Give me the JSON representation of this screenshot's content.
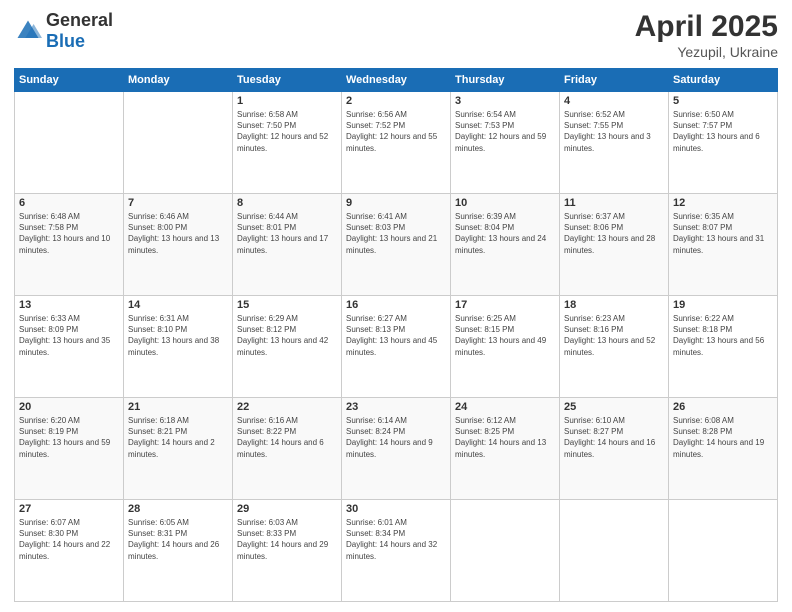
{
  "header": {
    "logo": {
      "general": "General",
      "blue": "Blue"
    },
    "title": "April 2025",
    "location": "Yezupil, Ukraine"
  },
  "weekdays": [
    "Sunday",
    "Monday",
    "Tuesday",
    "Wednesday",
    "Thursday",
    "Friday",
    "Saturday"
  ],
  "weeks": [
    [
      {
        "day": "",
        "info": ""
      },
      {
        "day": "",
        "info": ""
      },
      {
        "day": "1",
        "info": "Sunrise: 6:58 AM\nSunset: 7:50 PM\nDaylight: 12 hours and 52 minutes."
      },
      {
        "day": "2",
        "info": "Sunrise: 6:56 AM\nSunset: 7:52 PM\nDaylight: 12 hours and 55 minutes."
      },
      {
        "day": "3",
        "info": "Sunrise: 6:54 AM\nSunset: 7:53 PM\nDaylight: 12 hours and 59 minutes."
      },
      {
        "day": "4",
        "info": "Sunrise: 6:52 AM\nSunset: 7:55 PM\nDaylight: 13 hours and 3 minutes."
      },
      {
        "day": "5",
        "info": "Sunrise: 6:50 AM\nSunset: 7:57 PM\nDaylight: 13 hours and 6 minutes."
      }
    ],
    [
      {
        "day": "6",
        "info": "Sunrise: 6:48 AM\nSunset: 7:58 PM\nDaylight: 13 hours and 10 minutes."
      },
      {
        "day": "7",
        "info": "Sunrise: 6:46 AM\nSunset: 8:00 PM\nDaylight: 13 hours and 13 minutes."
      },
      {
        "day": "8",
        "info": "Sunrise: 6:44 AM\nSunset: 8:01 PM\nDaylight: 13 hours and 17 minutes."
      },
      {
        "day": "9",
        "info": "Sunrise: 6:41 AM\nSunset: 8:03 PM\nDaylight: 13 hours and 21 minutes."
      },
      {
        "day": "10",
        "info": "Sunrise: 6:39 AM\nSunset: 8:04 PM\nDaylight: 13 hours and 24 minutes."
      },
      {
        "day": "11",
        "info": "Sunrise: 6:37 AM\nSunset: 8:06 PM\nDaylight: 13 hours and 28 minutes."
      },
      {
        "day": "12",
        "info": "Sunrise: 6:35 AM\nSunset: 8:07 PM\nDaylight: 13 hours and 31 minutes."
      }
    ],
    [
      {
        "day": "13",
        "info": "Sunrise: 6:33 AM\nSunset: 8:09 PM\nDaylight: 13 hours and 35 minutes."
      },
      {
        "day": "14",
        "info": "Sunrise: 6:31 AM\nSunset: 8:10 PM\nDaylight: 13 hours and 38 minutes."
      },
      {
        "day": "15",
        "info": "Sunrise: 6:29 AM\nSunset: 8:12 PM\nDaylight: 13 hours and 42 minutes."
      },
      {
        "day": "16",
        "info": "Sunrise: 6:27 AM\nSunset: 8:13 PM\nDaylight: 13 hours and 45 minutes."
      },
      {
        "day": "17",
        "info": "Sunrise: 6:25 AM\nSunset: 8:15 PM\nDaylight: 13 hours and 49 minutes."
      },
      {
        "day": "18",
        "info": "Sunrise: 6:23 AM\nSunset: 8:16 PM\nDaylight: 13 hours and 52 minutes."
      },
      {
        "day": "19",
        "info": "Sunrise: 6:22 AM\nSunset: 8:18 PM\nDaylight: 13 hours and 56 minutes."
      }
    ],
    [
      {
        "day": "20",
        "info": "Sunrise: 6:20 AM\nSunset: 8:19 PM\nDaylight: 13 hours and 59 minutes."
      },
      {
        "day": "21",
        "info": "Sunrise: 6:18 AM\nSunset: 8:21 PM\nDaylight: 14 hours and 2 minutes."
      },
      {
        "day": "22",
        "info": "Sunrise: 6:16 AM\nSunset: 8:22 PM\nDaylight: 14 hours and 6 minutes."
      },
      {
        "day": "23",
        "info": "Sunrise: 6:14 AM\nSunset: 8:24 PM\nDaylight: 14 hours and 9 minutes."
      },
      {
        "day": "24",
        "info": "Sunrise: 6:12 AM\nSunset: 8:25 PM\nDaylight: 14 hours and 13 minutes."
      },
      {
        "day": "25",
        "info": "Sunrise: 6:10 AM\nSunset: 8:27 PM\nDaylight: 14 hours and 16 minutes."
      },
      {
        "day": "26",
        "info": "Sunrise: 6:08 AM\nSunset: 8:28 PM\nDaylight: 14 hours and 19 minutes."
      }
    ],
    [
      {
        "day": "27",
        "info": "Sunrise: 6:07 AM\nSunset: 8:30 PM\nDaylight: 14 hours and 22 minutes."
      },
      {
        "day": "28",
        "info": "Sunrise: 6:05 AM\nSunset: 8:31 PM\nDaylight: 14 hours and 26 minutes."
      },
      {
        "day": "29",
        "info": "Sunrise: 6:03 AM\nSunset: 8:33 PM\nDaylight: 14 hours and 29 minutes."
      },
      {
        "day": "30",
        "info": "Sunrise: 6:01 AM\nSunset: 8:34 PM\nDaylight: 14 hours and 32 minutes."
      },
      {
        "day": "",
        "info": ""
      },
      {
        "day": "",
        "info": ""
      },
      {
        "day": "",
        "info": ""
      }
    ]
  ]
}
